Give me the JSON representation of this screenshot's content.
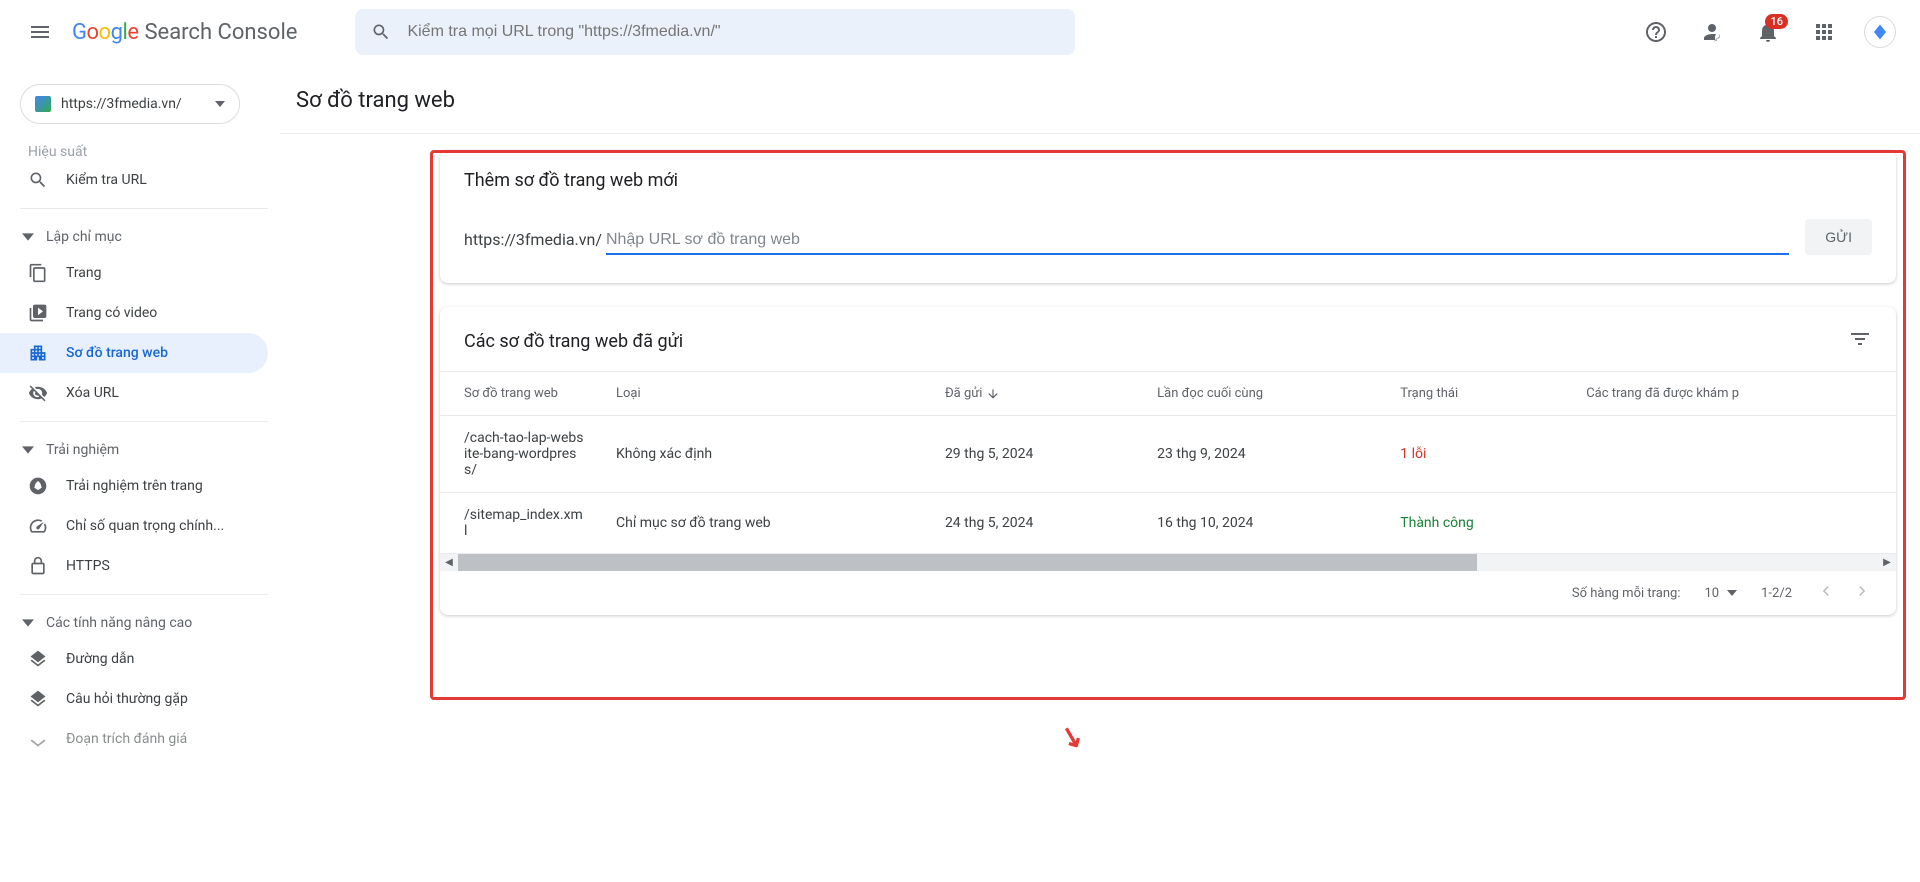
{
  "header": {
    "product": "Search Console",
    "search_placeholder": "Kiểm tra mọi URL trong \"https://3fmedia.vn/\"",
    "notif_count": "16"
  },
  "sidebar": {
    "property": "https://3fmedia.vn/",
    "partial_top": "Hiệu suất",
    "inspect": "Kiểm tra URL",
    "section_index": "Lập chỉ mục",
    "pages": "Trang",
    "video_pages": "Trang có video",
    "sitemaps": "Sơ đồ trang web",
    "removals": "Xóa URL",
    "section_exp": "Trải nghiệm",
    "page_exp": "Trải nghiệm trên trang",
    "cwv": "Chỉ số quan trọng chính...",
    "https": "HTTPS",
    "section_adv": "Các tính năng nâng cao",
    "breadcrumbs": "Đường dẫn",
    "faq": "Câu hỏi thường gặp",
    "partial_bottom": "Đoạn trích đánh giá"
  },
  "page": {
    "title": "Sơ đồ trang web"
  },
  "add_card": {
    "title": "Thêm sơ đồ trang web mới",
    "prefix": "https://3fmedia.vn/",
    "placeholder": "Nhập URL sơ đồ trang web",
    "submit": "GỬI"
  },
  "list_card": {
    "title": "Các sơ đồ trang web đã gửi",
    "columns": {
      "sitemap": "Sơ đồ trang web",
      "type": "Loại",
      "submitted": "Đã gửi",
      "last_read": "Lần đọc cuối cùng",
      "status": "Trạng thái",
      "discovered": "Các trang đã được khám p"
    },
    "rows": [
      {
        "url": "/cach-tao-lap-website-bang-wordpress/",
        "type": "Không xác định",
        "submitted": "29 thg 5, 2024",
        "last_read": "23 thg 9, 2024",
        "status": "1 lỗi",
        "status_class": "status-error"
      },
      {
        "url": "/sitemap_index.xml",
        "type": "Chỉ mục sơ đồ trang web",
        "submitted": "24 thg 5, 2024",
        "last_read": "16 thg 10, 2024",
        "status": "Thành công",
        "status_class": "status-success"
      }
    ],
    "pager": {
      "rows_label": "Số hàng mỗi trang:",
      "rows_value": "10",
      "range": "1-2/2"
    }
  }
}
